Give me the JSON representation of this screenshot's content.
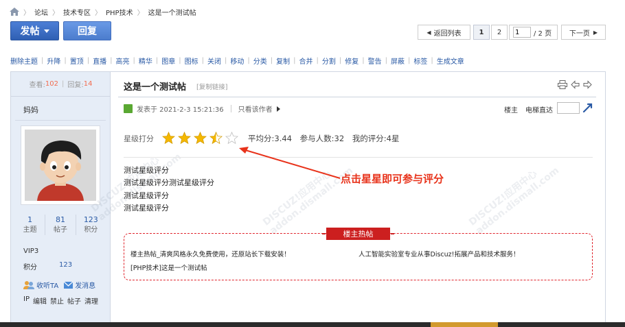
{
  "breadcrumb": [
    "论坛",
    "技术专区",
    "PHP技术",
    "这是一个测试帖"
  ],
  "buttons": {
    "post": "发帖",
    "reply": "回复"
  },
  "pager": {
    "back": "返回列表",
    "page1": "1",
    "page2": "2",
    "current": "1",
    "total": "/ 2 页",
    "next": "下一页"
  },
  "admin_actions": [
    "删除主题",
    "升降",
    "置顶",
    "直播",
    "高亮",
    "精华",
    "图章",
    "图标",
    "关闭",
    "移动",
    "分类",
    "复制",
    "合并",
    "分割",
    "修复",
    "警告",
    "屏蔽",
    "标签",
    "生成文章"
  ],
  "sidebar": {
    "views_label": "查看:",
    "views": "102",
    "replies_label": "回复:",
    "replies": "14",
    "author": "妈妈",
    "stats": [
      {
        "num": "1",
        "label": "主题"
      },
      {
        "num": "81",
        "label": "帖子"
      },
      {
        "num": "123",
        "label": "积分"
      }
    ],
    "group": "VIP3",
    "points_label": "积分",
    "points": "123",
    "follow": "收听TA",
    "message": "发消息",
    "admin_links": [
      "IP",
      "编辑",
      "禁止",
      "帖子",
      "清理"
    ]
  },
  "post": {
    "title": "这是一个测试帖",
    "copy_link": "[复制链接]",
    "posted_at": "发表于 2021-2-3 15:21:36",
    "only_author": "只看该作者",
    "floor": "楼主",
    "jump_label": "电梯直达",
    "rating_label": "星级打分",
    "rating": {
      "filled": 3,
      "half": 1,
      "empty": 1,
      "max": 5
    },
    "avg": "平均分:3.44",
    "participants": "参与人数:32",
    "my_rating": "我的评分:4星",
    "content": [
      "测试星级评分",
      "测试星级评分测试星级评分",
      "测试星级评分",
      "测试星级评分"
    ],
    "annotation": "点击星星即可参与评分"
  },
  "hot_posts": {
    "tag": "楼主热帖",
    "items": [
      "楼主热帖_清爽风格永久免费使用，还原站长下载安装！",
      "人工智能实验室专业从事Discuz!拓展产品和技术服务！",
      "[PHP技术]这是一个测试帖"
    ]
  },
  "watermark": {
    "brand": "DISCUZ!应用中心",
    "url": "addon.dismall.com"
  },
  "colors": {
    "accent": "#2f5fb3",
    "link": "#2a5aa5",
    "sidebar_bg": "#e6edf7",
    "star": "#f5b800",
    "annotation": "#e8321a",
    "hot_border": "#e0222a"
  }
}
